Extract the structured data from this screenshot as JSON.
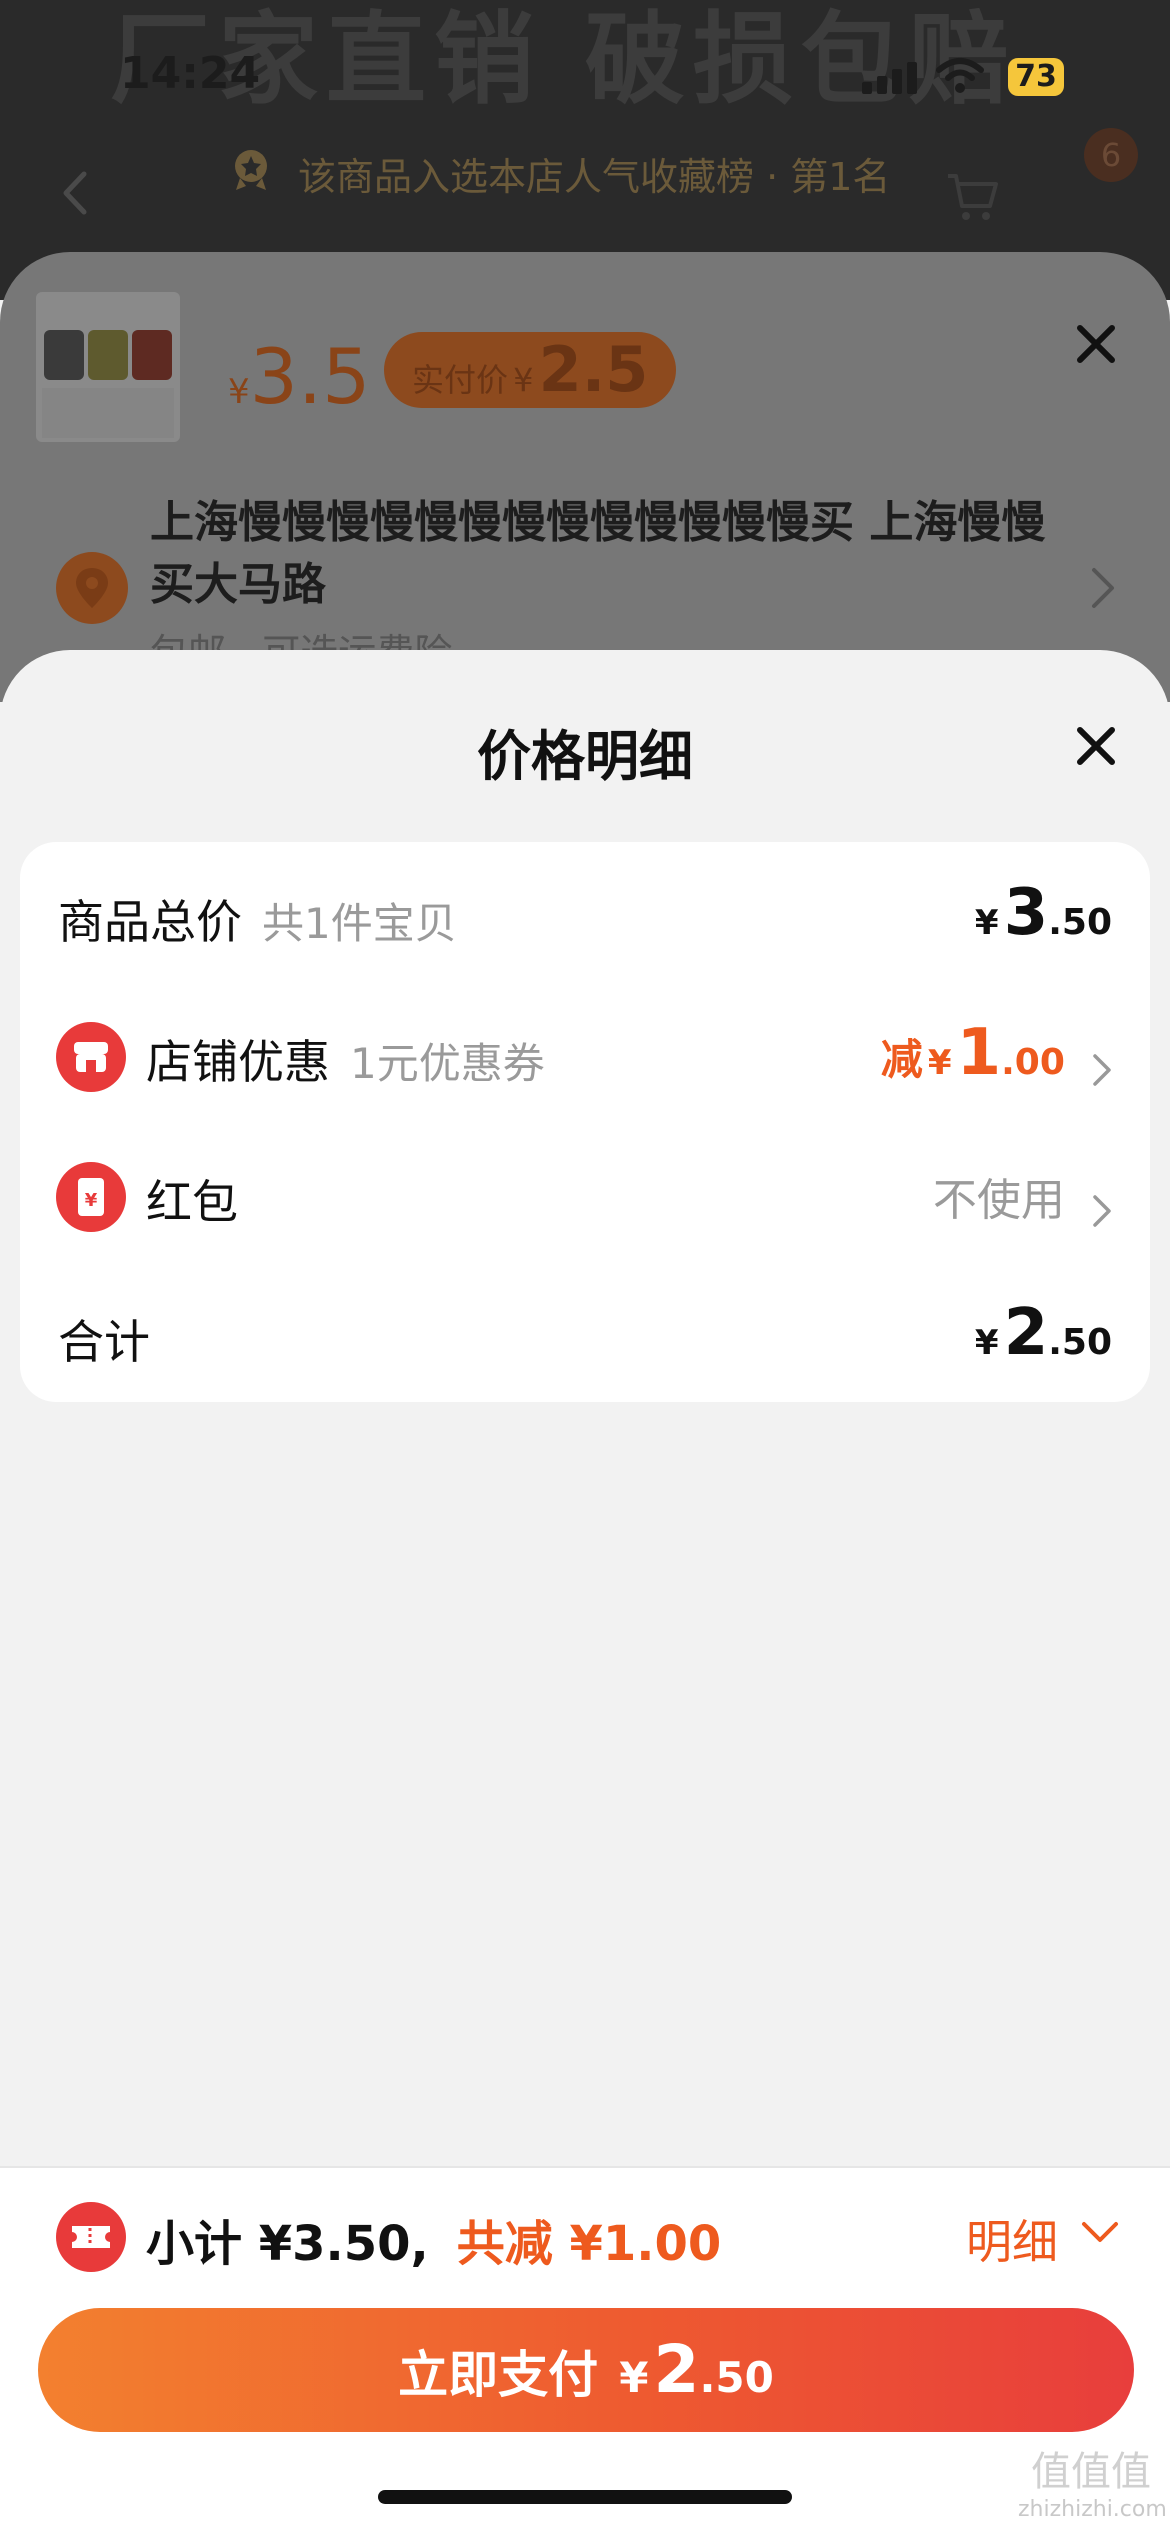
{
  "status_bar": {
    "time": "14:24",
    "battery": "73"
  },
  "background": {
    "banner_text": "厂家直销 破损包赔",
    "rank_notice": "该商品入选本店人气收藏榜 · 第1名",
    "cart_badge": "6"
  },
  "product": {
    "price_currency": "¥",
    "price": "3.5",
    "pay_label": "实付价",
    "pay_currency": "¥",
    "pay_price": "2.5",
    "address_line": "上海慢慢慢慢慢慢慢慢慢慢慢慢慢买 上海慢慢买大马路",
    "shipping_note": "包邮 · 可选运费险"
  },
  "sheet": {
    "title": "价格明细",
    "rows": [
      {
        "label": "商品总价",
        "sub": "共1件宝贝",
        "currency": "¥",
        "int": "3",
        "dec": ".50"
      },
      {
        "label": "店铺优惠",
        "sub": "1元优惠券",
        "prefix": "减",
        "currency": "¥",
        "int": "1",
        "dec": ".00",
        "icon": "shop-icon"
      },
      {
        "label": "红包",
        "value_text": "不使用",
        "icon": "red-packet-icon"
      },
      {
        "label": "合计",
        "currency": "¥",
        "int": "2",
        "dec": ".50"
      }
    ]
  },
  "bottom_bar": {
    "subtotal": "小计 ¥3.50,",
    "reduce": "共减 ¥1.00",
    "detail_label": "明细",
    "pay_label": "立即支付",
    "pay_currency": "¥",
    "pay_int": "2",
    "pay_dec": ".50"
  },
  "watermark": {
    "glyphs": "值值值",
    "domain": "zhizhizhi.com"
  },
  "colors": {
    "accent": "#ee5a1e",
    "red": "#e83a3a",
    "pay_start": "#f3802f",
    "pay_end": "#e83e3c"
  }
}
